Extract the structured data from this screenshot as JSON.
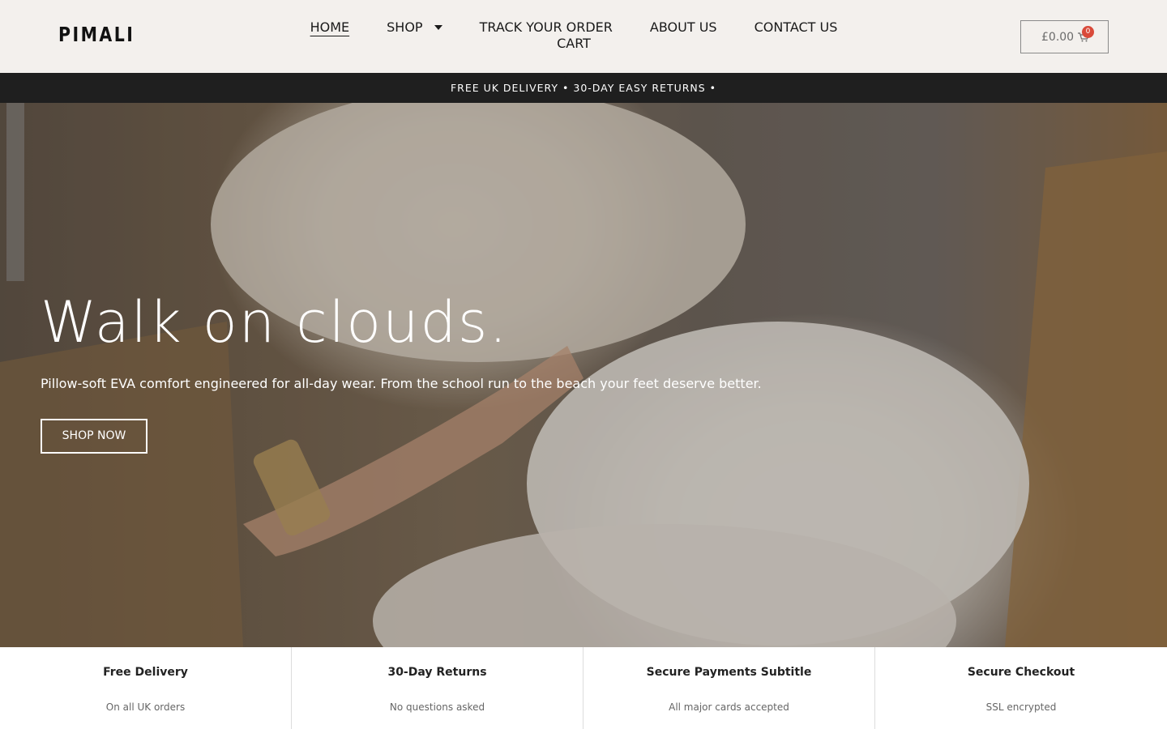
{
  "header": {
    "logo": "PIMALI",
    "nav": [
      {
        "label": "HOME",
        "active": true
      },
      {
        "label": "SHOP",
        "has_dropdown": true
      },
      {
        "label": "TRACK YOUR ORDER"
      },
      {
        "label": "ABOUT US"
      },
      {
        "label": "CONTACT US"
      },
      {
        "label": "CART"
      }
    ],
    "cart": {
      "amount": "£0.00",
      "count": "0",
      "icon": "cart-icon"
    }
  },
  "announcement": "FREE UK DELIVERY • 30-DAY EASY RETURNS •",
  "hero": {
    "title": "Walk on clouds.",
    "subtitle": "Pillow-soft EVA comfort engineered for all-day wear. From the school run to the beach your feet deserve better.",
    "cta": "SHOP NOW"
  },
  "features": [
    {
      "title": "Free Delivery",
      "subtitle": "On all UK orders"
    },
    {
      "title": "30-Day Returns",
      "subtitle": "No questions asked"
    },
    {
      "title": "Secure Payments Subtitle",
      "subtitle": "All major cards accepted"
    },
    {
      "title": "Secure Checkout",
      "subtitle": "SSL encrypted"
    }
  ],
  "colors": {
    "header_bg": "#f3f0ed",
    "announce_bg": "#1f1f1f",
    "badge": "#d94a3a"
  }
}
